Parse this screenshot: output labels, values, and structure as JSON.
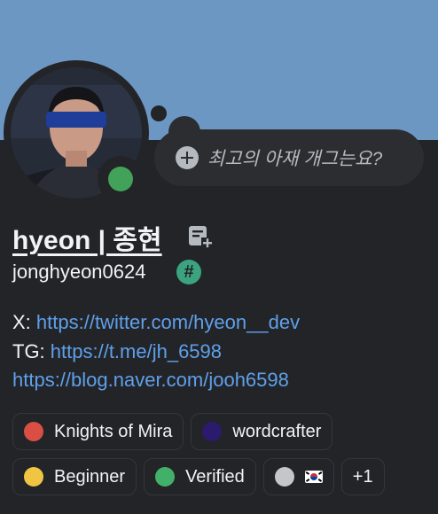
{
  "profile": {
    "display_name": "hyeon | 종현",
    "username": "jonghyeon0624",
    "status_prompt": "최고의 아재 개그는요?",
    "status_color": "#43a25a",
    "banner_color": "#6d97c3",
    "hash_badge": "#"
  },
  "bio": {
    "line1_prefix": "X: ",
    "line1_link": "https://twitter.com/hyeon__dev",
    "line2_prefix": "TG: ",
    "line2_link": "https://t.me/jh_6598",
    "line3_link": "https://blog.naver.com/jooh6598"
  },
  "roles": [
    {
      "label": "Knights of Mira",
      "color": "#da4f43"
    },
    {
      "label": "wordcrafter",
      "color": "#2b1a6e"
    },
    {
      "label": "Beginner",
      "color": "#f0c543"
    },
    {
      "label": "Verified",
      "color": "#43b06a"
    },
    {
      "label": "",
      "color": "#c4c6ca",
      "icon": "korea-flag-icon"
    },
    {
      "label": "+1"
    }
  ]
}
